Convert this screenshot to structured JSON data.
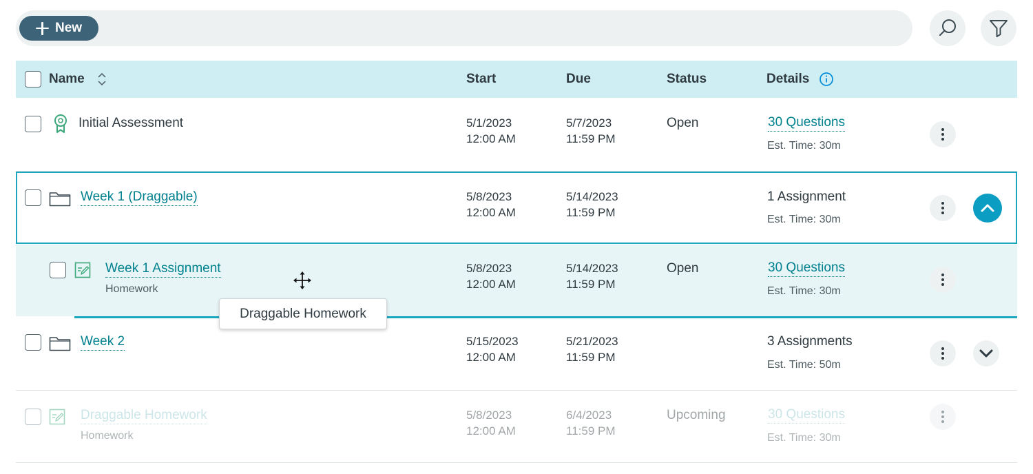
{
  "toolbar": {
    "new_label": "New"
  },
  "columns": {
    "name": "Name",
    "start": "Start",
    "due": "Due",
    "status": "Status",
    "details": "Details"
  },
  "rows": [
    {
      "name": "Initial Assessment",
      "start_date": "5/1/2023",
      "start_time": "12:00 AM",
      "due_date": "5/7/2023",
      "due_time": "11:59 PM",
      "status": "Open",
      "details": "30 Questions",
      "est": "Est. Time: 30m"
    },
    {
      "name": "Week 1 (Draggable)",
      "start_date": "5/8/2023",
      "start_time": "12:00 AM",
      "due_date": "5/14/2023",
      "due_time": "11:59 PM",
      "status": "",
      "details": "1 Assignment",
      "est": "Est. Time: 30m"
    },
    {
      "name": "Week 1 Assignment",
      "type": "Homework",
      "start_date": "5/8/2023",
      "start_time": "12:00 AM",
      "due_date": "5/14/2023",
      "due_time": "11:59 PM",
      "status": "Open",
      "details": "30 Questions",
      "est": "Est. Time: 30m"
    },
    {
      "name": "Week 2",
      "start_date": "5/15/2023",
      "start_time": "12:00 AM",
      "due_date": "5/21/2023",
      "due_time": "11:59 PM",
      "status": "",
      "details": "3 Assignments",
      "est": "Est. Time: 50m"
    },
    {
      "name": "Draggable Homework",
      "type": "Homework",
      "start_date": "5/8/2023",
      "start_time": "12:00 AM",
      "due_date": "6/4/2023",
      "due_time": "11:59 PM",
      "status": "Upcoming",
      "details": "30 Questions",
      "est": "Est. Time: 30m"
    }
  ],
  "tooltip": "Draggable Homework",
  "colors": {
    "accent": "#00818e",
    "new_button": "#3c6378",
    "header_bg": "#cfeef3",
    "expand_button": "#0b9dc2"
  },
  "icons": [
    "plus-icon",
    "search-icon",
    "filter-icon",
    "sort-icon",
    "info-icon",
    "ribbon-badge-icon",
    "folder-icon",
    "homework-icon",
    "kebab-icon",
    "chevron-up-icon",
    "chevron-down-icon",
    "move-cursor-icon"
  ]
}
